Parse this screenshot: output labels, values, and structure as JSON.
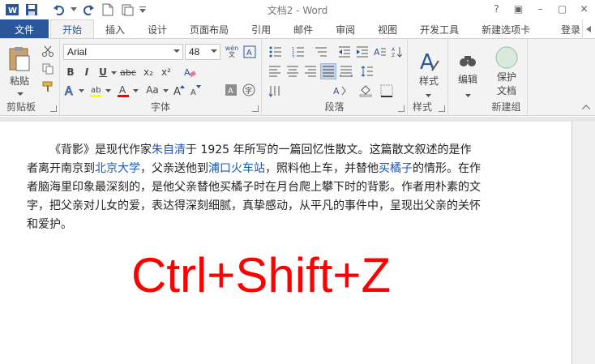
{
  "app": {
    "title": "文档2 - Word",
    "window_controls": [
      "?",
      "▣",
      "–",
      "▢",
      "✕"
    ]
  },
  "tabs": {
    "file": "文件",
    "items": [
      "开始",
      "插入",
      "设计",
      "页面布局",
      "引用",
      "邮件",
      "审阅",
      "视图",
      "开发工具",
      "新建选项卡"
    ],
    "active": "开始",
    "login": "登录"
  },
  "ribbon": {
    "clipboard": {
      "label": "剪贴板",
      "paste": "粘贴"
    },
    "font": {
      "label": "字体",
      "name": "Arial",
      "size": "48",
      "bold": "B",
      "italic": "I",
      "underline": "U",
      "strike": "abc",
      "subscript": "x₂",
      "superscript": "x²",
      "grow": "A",
      "shrink": "Aa",
      "wen": "wén"
    },
    "paragraph": {
      "label": "段落"
    },
    "styles": {
      "label": "样式",
      "button": "样式"
    },
    "editing": {
      "button": "编辑"
    },
    "newgroup": {
      "label": "新建组",
      "protect1": "保护",
      "protect2": "文档"
    }
  },
  "document": {
    "paragraph": [
      {
        "t": "《背影》是现代作家",
        "link": false
      },
      {
        "t": "朱自清",
        "link": true
      },
      {
        "t": "于 1925 年所写的一篇回忆性散文。这篇散文叙述的是作者离开南京到",
        "link": false
      },
      {
        "t": "北京大学",
        "link": true
      },
      {
        "t": "，父亲送他到",
        "link": false
      },
      {
        "t": "浦口火车站",
        "link": true
      },
      {
        "t": "，照料他上车，并替他",
        "link": false
      },
      {
        "t": "买橘子",
        "link": true
      },
      {
        "t": "的情形。在作者脑海里印象最深刻的，是他父亲替他买橘子时在月台爬上攀下时的背影。作者用朴素的文字，把父亲对儿女的爱，表达得深刻细腻，真挚感动，从平凡的事件中，呈现出父亲的关怀和爱护。",
        "link": false
      }
    ],
    "shortcut": "Ctrl+Shift+Z"
  },
  "colors": {
    "accent": "#2b579a",
    "link": "#1a57b6",
    "shortcut": "#ff0000",
    "highlight": "#ffff00",
    "font_color": "#ff0000"
  }
}
